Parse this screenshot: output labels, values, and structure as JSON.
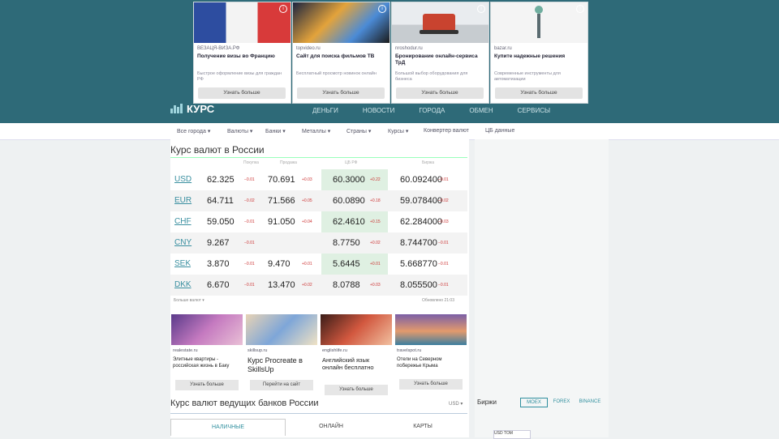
{
  "ads": [
    {
      "source": "ВЕЗАЦЯ-ВИЗА.РФ",
      "title": "Получение визы во Францию",
      "desc": "Быстрое оформление визы для граждан РФ",
      "button": "Узнать больше"
    },
    {
      "source": "topvideo.ru",
      "title": "Сайт для поиска фильмов TB",
      "desc": "Бесплатный просмотр новинок онлайн",
      "button": "Узнать больше"
    },
    {
      "source": "nroshodur.ru",
      "title": "Бронирование онлайн-сервиса ТрД",
      "desc": "Большой выбор оборудования для бизнеса",
      "button": "Узнать больше"
    },
    {
      "source": "bazar.ru",
      "title": "Купите надежные решения",
      "desc": "Современные инструменты для автоматизации",
      "button": "Узнать больше"
    }
  ],
  "site": {
    "logo": "КУРС"
  },
  "topnav": [
    "ДЕНЬГИ",
    "НОВОСТИ",
    "ГОРОДА",
    "ОБМЕН",
    "СЕРВИСЫ"
  ],
  "subnav": [
    "Все города ▾",
    "Валюты ▾",
    "Банки ▾",
    "Металлы ▾",
    "Страны ▾",
    "Курсы ▾",
    "Конвертер валют",
    "ЦБ данные"
  ],
  "main": {
    "title": "Курс валют в России",
    "col_heads": [
      "Покупка",
      "Продажа",
      "ЦБ РФ",
      "Биржа"
    ],
    "rows": [
      {
        "code": "USD",
        "buy": "62.325",
        "buy_d": "−0.01",
        "sell": "70.691",
        "sell_d": "+0.03",
        "cb": "60.3000",
        "cb_d": "+0.22",
        "ex": "60.092400",
        "ex_d": "−0.01"
      },
      {
        "code": "EUR",
        "buy": "64.711",
        "buy_d": "−0.02",
        "sell": "71.566",
        "sell_d": "+0.05",
        "cb": "60.0890",
        "cb_d": "+0.18",
        "ex": "59.078400",
        "ex_d": "−0.02"
      },
      {
        "code": "CHF",
        "buy": "59.050",
        "buy_d": "−0.01",
        "sell": "91.050",
        "sell_d": "+0.04",
        "cb": "62.4610",
        "cb_d": "+0.15",
        "ex": "62.284000",
        "ex_d": "−0.03"
      },
      {
        "code": "CNY",
        "buy": "9.267",
        "buy_d": "−0.01",
        "sell": "",
        "sell_d": "",
        "cb": "8.7750",
        "cb_d": "+0.02",
        "ex": "8.744700",
        "ex_d": "−0.01"
      },
      {
        "code": "SEK",
        "buy": "3.870",
        "buy_d": "−0.01",
        "sell": "9.470",
        "sell_d": "+0.01",
        "cb": "5.6445",
        "cb_d": "+0.01",
        "ex": "5.668770",
        "ex_d": "−0.01"
      },
      {
        "code": "DKK",
        "buy": "6.670",
        "buy_d": "−0.01",
        "sell": "13.470",
        "sell_d": "+0.02",
        "cb": "8.0788",
        "cb_d": "+0.03",
        "ex": "8.055500",
        "ex_d": "−0.01"
      }
    ],
    "more_link": "Больше валют ▾",
    "updated": "Обновлено 21:03"
  },
  "cards": [
    {
      "source": "realestate.ru",
      "title": "Элитные квартиры - российская жизнь в Баку",
      "button": "Узнать больше"
    },
    {
      "source": "skillsup.ru",
      "title": "Курс Procreate в SkillsUp",
      "button": "Перейти на сайт"
    },
    {
      "source": "englishlife.ru",
      "title": "Английский язык онлайн бесплатно",
      "button": "Узнать больше"
    },
    {
      "source": "travelspot.ru",
      "title": "Отели на Северном побережье Крыма",
      "button": "Узнать больше"
    }
  ],
  "banks": {
    "title": "Курс валют ведущих банков России",
    "currency": "USD ▾",
    "tabs": [
      "НАЛИЧНЫЕ",
      "ОНЛАЙН",
      "КАРТЫ"
    ]
  },
  "birzhi": {
    "title": "Биржи",
    "tabs": [
      "MOEX",
      "FOREX",
      "BINANCE"
    ],
    "mini_label": "USD TOM"
  }
}
